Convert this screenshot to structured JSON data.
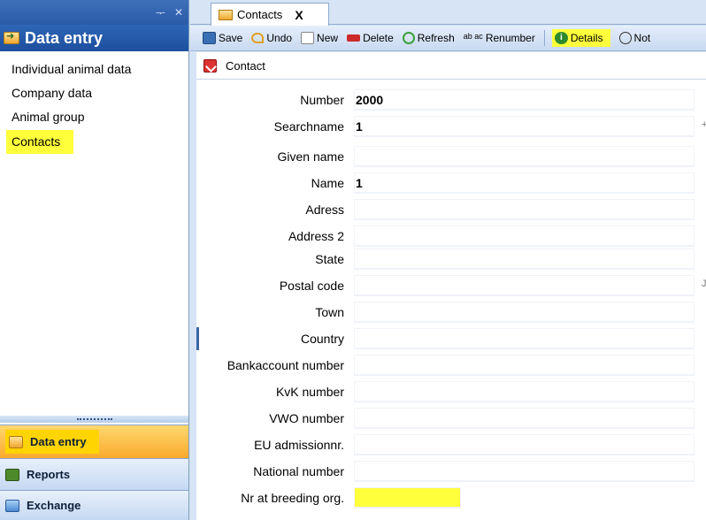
{
  "left_pane": {
    "pin_icon": "pin-icon",
    "close_icon": "close-icon",
    "title": "Data entry",
    "items": [
      {
        "label": "Individual animal data"
      },
      {
        "label": "Company data"
      },
      {
        "label": "Animal group"
      },
      {
        "label": "Contacts",
        "highlighted": true
      }
    ],
    "bottom_buttons": [
      {
        "label": "Data entry",
        "active": true
      },
      {
        "label": "Reports"
      },
      {
        "label": "Exchange"
      }
    ]
  },
  "tabs": [
    {
      "label": "Contacts",
      "close": "X"
    }
  ],
  "toolbar": {
    "save": "Save",
    "undo": "Undo",
    "new": "New",
    "delete": "Delete",
    "refresh": "Refresh",
    "renumber_icon_text": "ab ac",
    "renumber": "Renumber",
    "details": "Details",
    "notes": "Not"
  },
  "form": {
    "section_title": "Contact",
    "fields": [
      {
        "label": "Number",
        "value": "2000"
      },
      {
        "label": "Searchname",
        "value": "1"
      },
      {
        "label": "Given name",
        "value": ""
      },
      {
        "label": "Name",
        "value": "1"
      },
      {
        "label": "Adress",
        "value": ""
      },
      {
        "label": "Address 2",
        "value": ""
      },
      {
        "label": "State",
        "value": ""
      },
      {
        "label": "Postal code",
        "value": ""
      },
      {
        "label": "Town",
        "value": ""
      },
      {
        "label": "Country",
        "value": ""
      },
      {
        "label": "Bankaccount number",
        "value": ""
      },
      {
        "label": "KvK number",
        "value": ""
      },
      {
        "label": "VWO number",
        "value": ""
      },
      {
        "label": "EU admissionnr.",
        "value": ""
      },
      {
        "label": "National number",
        "value": ""
      },
      {
        "label": "Nr at breeding org.",
        "value": "",
        "highlighted": true
      }
    ],
    "edge_marks": [
      "+",
      "J"
    ]
  },
  "colors": {
    "highlight": "#ffff3c",
    "nav_title_bg": "#2b5ba8",
    "active_button_bg": "#f9a92c"
  }
}
